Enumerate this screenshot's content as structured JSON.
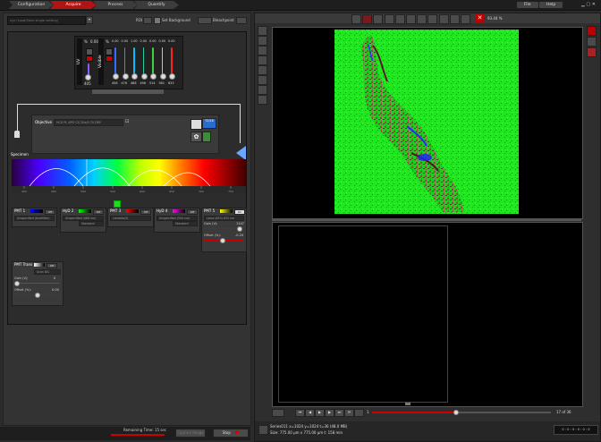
{
  "tabs": [
    {
      "label": "Configuration",
      "active": false
    },
    {
      "label": "Acquire",
      "active": true
    },
    {
      "label": "Process",
      "active": false
    },
    {
      "label": "Quantify",
      "active": false
    }
  ],
  "menu": {
    "file": "File",
    "help": "Help"
  },
  "left_header": {
    "mode_text": "xyz   (Load/Save single setting)",
    "roi": "ROI",
    "set_background": "Set Background",
    "bleach_point": "Bleachpoint"
  },
  "laser_panel": {
    "uv_label": "UV",
    "uv_pct_symbol": "%",
    "uv_value": "0.00",
    "uv_wavelength": "405",
    "visible_label": "Visible",
    "visible_pct_symbol": "%",
    "visible_values": [
      "0.00",
      "0.00",
      "1.00",
      "0.00",
      "0.00",
      "0.00",
      "0.00"
    ],
    "visible_wavelengths": [
      "458",
      "476",
      "488",
      "496",
      "514",
      "561",
      "633"
    ],
    "visible_colors": [
      "#3b6cff",
      "#2a8cff",
      "#00bfff",
      "#20d0a0",
      "#40d040",
      "#e0d020",
      "#ff2020"
    ]
  },
  "objective": {
    "label": "Objective",
    "value": "HCX PL APO CS    20x/0.70 DRY",
    "zoom_label": "72/28"
  },
  "specimen": {
    "label": "Specimen"
  },
  "spectrum": {
    "ticks": [
      "400",
      "450",
      "500",
      "550",
      "600",
      "650",
      "700",
      "750"
    ]
  },
  "detectors": [
    {
      "name": "PMT 1",
      "status": "Off",
      "field": "Unspecified (bluefilter)"
    },
    {
      "name": "HyD 2",
      "status": "Off",
      "field": "Unspecified (488 nm)",
      "mode": "Standard"
    },
    {
      "name": "PMT 3",
      "status": "Off",
      "field": "Lambda(3)"
    },
    {
      "name": "HyD 4",
      "status": "Off",
      "field": "Unspecified (594 nm)",
      "mode": "Standard"
    },
    {
      "name": "PMT 5",
      "status": "On",
      "field": "Leica (633) 633 nm",
      "gain_label": "Gain (V):",
      "gain_value": "1147",
      "offset_label": "Offset (%):",
      "offset_value": "-0.20"
    }
  ],
  "pmt_trans": {
    "name": "PMT Trans",
    "status": "Off",
    "field": "Scan DIC",
    "gain_label": "Gain (V):",
    "gain_value": "0",
    "offset_label": "Offset (%):",
    "offset_value": "0.00"
  },
  "bottom_left": {
    "remaining_label": "Remaining Time: 15 sec",
    "capture_image": "Capture Image",
    "stop": "Stop"
  },
  "viewer": {
    "zoom_value": "93.44 %",
    "frame_label": "1",
    "frame_counter": "17   of   36",
    "status_line1": "Series011 x=1024 y=1024 t=36 (48.0 MB)",
    "status_line2": "Size: 775.00 µm x 775.00 µm      t: 158 min",
    "status_right": "0 : 0 : 0 : 0 : 0 : 0"
  }
}
